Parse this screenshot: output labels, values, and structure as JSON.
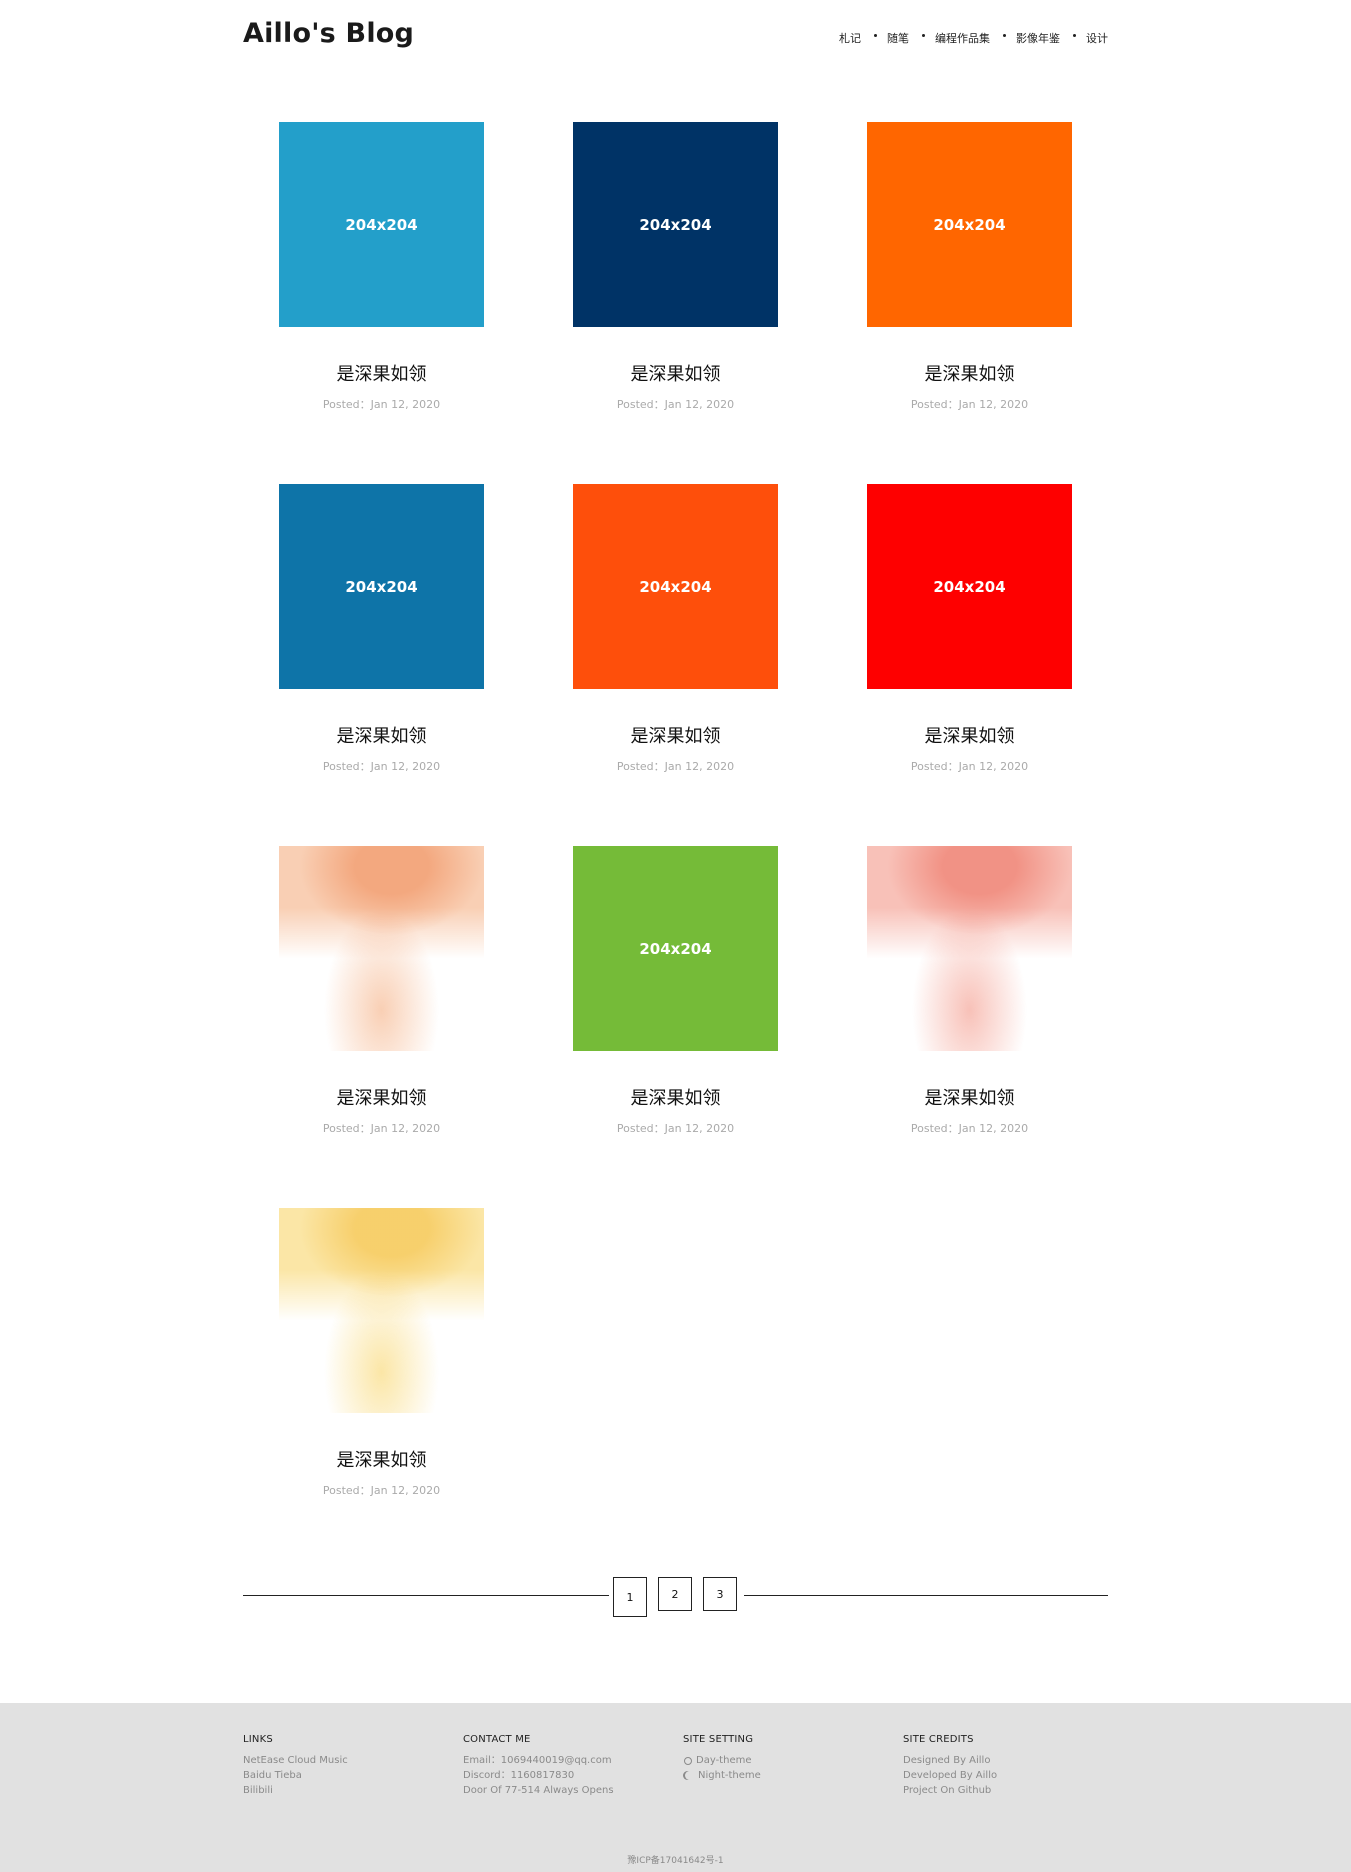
{
  "header": {
    "site_title": "Aillo's Blog",
    "nav": [
      "札记",
      "随笔",
      "编程作品集",
      "影像年鉴",
      "设计"
    ]
  },
  "posts": [
    {
      "thumb_label": "204x204",
      "thumb_color": "#239fca",
      "title": "是深果如领",
      "date": "Posted：Jan 12, 2020"
    },
    {
      "thumb_label": "204x204",
      "thumb_color": "#003366",
      "title": "是深果如领",
      "date": "Posted：Jan 12, 2020"
    },
    {
      "thumb_label": "204x204",
      "thumb_color": "#ff6600",
      "title": "是深果如领",
      "date": "Posted：Jan 12, 2020"
    },
    {
      "thumb_label": "204x204",
      "thumb_color": "#0e74a8",
      "title": "是深果如领",
      "date": "Posted：Jan 12, 2020"
    },
    {
      "thumb_label": "204x204",
      "thumb_color": "#fe4f0b",
      "title": "是深果如领",
      "date": "Posted：Jan 12, 2020"
    },
    {
      "thumb_label": "204x204",
      "thumb_color": "#fe0000",
      "title": "是深果如领",
      "date": "Posted：Jan 12, 2020"
    },
    {
      "thumb_label": "",
      "thumb_color": "#f9cfb4",
      "title": "是深果如领",
      "date": "Posted：Jan 12, 2020"
    },
    {
      "thumb_label": "204x204",
      "thumb_color": "#75bb38",
      "title": "是深果如领",
      "date": "Posted：Jan 12, 2020"
    },
    {
      "thumb_label": "",
      "thumb_color": "#f8c1b8",
      "title": "是深果如领",
      "date": "Posted：Jan 12, 2020"
    },
    {
      "thumb_label": "",
      "thumb_color": "#fbe6a6",
      "title": "是深果如领",
      "date": "Posted：Jan 12, 2020"
    }
  ],
  "pagination": {
    "pages": [
      "1",
      "2",
      "3"
    ],
    "current": "1"
  },
  "footer": {
    "links": {
      "heading": "LINKS",
      "items": [
        "NetEase Cloud Music",
        "Baidu Tieba",
        "Bilibili"
      ]
    },
    "contact": {
      "heading": "CONTACT ME",
      "items": [
        "Email：1069440019@qq.com",
        "Discord：1160817830",
        "Door Of 77-514 Always Opens"
      ]
    },
    "settings": {
      "heading": "SITE SETTING",
      "items": [
        {
          "icon": "sun-icon",
          "label": "Day-theme"
        },
        {
          "icon": "moon-icon",
          "label": "Night-theme"
        }
      ]
    },
    "credits": {
      "heading": "SITE CREDITS",
      "items": [
        "Designed By Aillo",
        "Developed By Aillo",
        "Project On Github"
      ]
    },
    "icp": "豫ICP备17041642号-1"
  }
}
